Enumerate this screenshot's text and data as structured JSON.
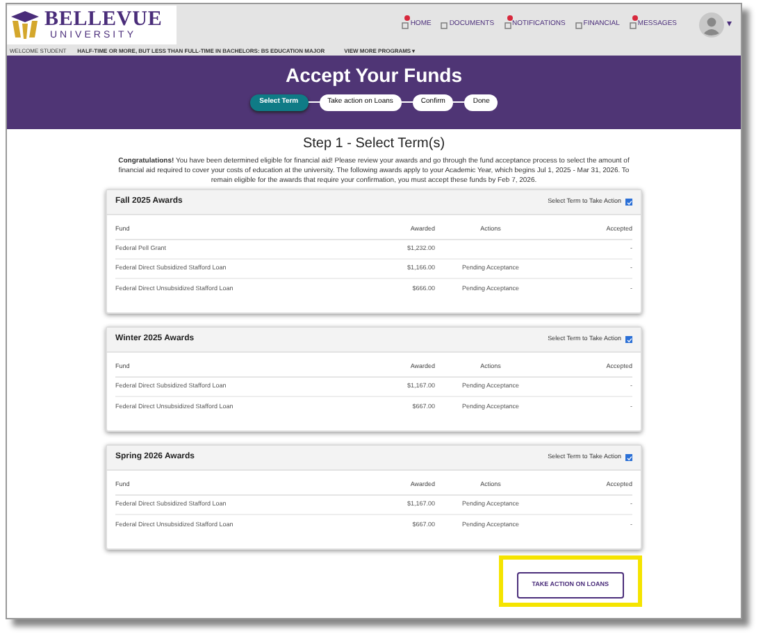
{
  "header": {
    "logo_title": "BELLEVUE",
    "logo_subtitle": "UNIVERSITY",
    "nav": [
      {
        "label": "HOME",
        "badge": true
      },
      {
        "label": "DOCUMENTS",
        "badge": false
      },
      {
        "label": "NOTIFICATIONS",
        "badge": true
      },
      {
        "label": "FINANCIAL",
        "badge": false
      },
      {
        "label": "MESSAGES",
        "badge": true
      }
    ],
    "caret": "▾"
  },
  "subheader": {
    "welcome": "WELCOME STUDENT",
    "program": "HALF-TIME OR MORE, BUT LESS THAN FULL-TIME IN BACHELORS: BS EDUCATION MAJOR",
    "more": "VIEW MORE PROGRAMS",
    "more_caret": "▾"
  },
  "banner": {
    "title": "Accept Your Funds",
    "steps": [
      {
        "label": "Select Term",
        "selected": true
      },
      {
        "label": "Take action on Loans",
        "selected": false
      },
      {
        "label": "Confirm",
        "selected": false
      },
      {
        "label": "Done",
        "selected": false
      }
    ]
  },
  "step_title": "Step 1 - Select Term(s)",
  "intro": "**Congratulations!** You have been determined eligible for financial aid! Please review your awards and go through the fund acceptance process to select the amount of financial aid required to cover your costs of education at the university. The following awards apply to your Academic Year, which begins Jul 1, 2025 - Mar 31, 2026. To remain eligible for the awards that require your confirmation, you must accept these funds by Feb 7, 2026.",
  "terms": [
    {
      "title": "Fall 2025 Awards",
      "select_label": "Select Term to Take Action",
      "checked": true,
      "columns": [
        "Fund",
        "Awarded",
        "Actions",
        "Accepted"
      ],
      "rows": [
        [
          "Federal Pell Grant",
          "$1,232.00",
          "",
          "-"
        ],
        [
          "Federal Direct Subsidized Stafford Loan",
          "$1,166.00",
          "Pending Acceptance",
          "-"
        ],
        [
          "Federal Direct Unsubsidized Stafford Loan",
          "$666.00",
          "Pending Acceptance",
          "-"
        ]
      ]
    },
    {
      "title": "Winter 2025 Awards",
      "select_label": "Select Term to Take Action",
      "checked": true,
      "columns": [
        "Fund",
        "Awarded",
        "Actions",
        "Accepted"
      ],
      "rows": [
        [
          "Federal Direct Subsidized Stafford Loan",
          "$1,167.00",
          "Pending Acceptance",
          "-"
        ],
        [
          "Federal Direct Unsubsidized Stafford Loan",
          "$667.00",
          "Pending Acceptance",
          "-"
        ]
      ]
    },
    {
      "title": "Spring 2026 Awards",
      "select_label": "Select Term to Take Action",
      "checked": true,
      "columns": [
        "Fund",
        "Awarded",
        "Actions",
        "Accepted"
      ],
      "rows": [
        [
          "Federal Direct Subsidized Stafford Loan",
          "$1,167.00",
          "Pending Acceptance",
          "-"
        ],
        [
          "Federal Direct Unsubsidized Stafford Loan",
          "$667.00",
          "Pending Acceptance",
          "-"
        ]
      ]
    }
  ],
  "action_button": "TAKE ACTION ON LOANS"
}
